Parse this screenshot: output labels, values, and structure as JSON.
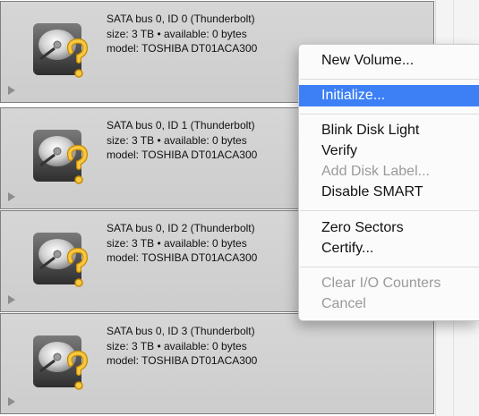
{
  "disks": [
    {
      "line1": "SATA bus 0, ID 0 (Thunderbolt)",
      "line2": "size: 3 TB • available: 0 bytes",
      "line3": "model: TOSHIBA DT01ACA300"
    },
    {
      "line1": "SATA bus 0, ID 1 (Thunderbolt)",
      "line2": "size: 3 TB • available: 0 bytes",
      "line3": "model: TOSHIBA DT01ACA300"
    },
    {
      "line1": "SATA bus 0, ID 2 (Thunderbolt)",
      "line2": "size: 3 TB • available: 0 bytes",
      "line3": "model: TOSHIBA DT01ACA300"
    },
    {
      "line1": "SATA bus 0, ID 3 (Thunderbolt)",
      "line2": "size: 3 TB • available: 0 bytes",
      "line3": "model: TOSHIBA DT01ACA300"
    }
  ],
  "icons": {
    "disk": "hard-drive-unknown-icon",
    "disclosure": "disclosure-triangle-icon"
  },
  "menu": {
    "selected_color": "#3d80f6",
    "items": {
      "new_volume": "New Volume...",
      "initialize": "Initialize...",
      "blink": "Blink Disk Light",
      "verify": "Verify",
      "add_label": "Add Disk Label...",
      "disable_smart": "Disable SMART",
      "zero_sectors": "Zero Sectors",
      "certify": "Certify...",
      "clear_io": "Clear I/O Counters",
      "cancel": "Cancel"
    }
  }
}
